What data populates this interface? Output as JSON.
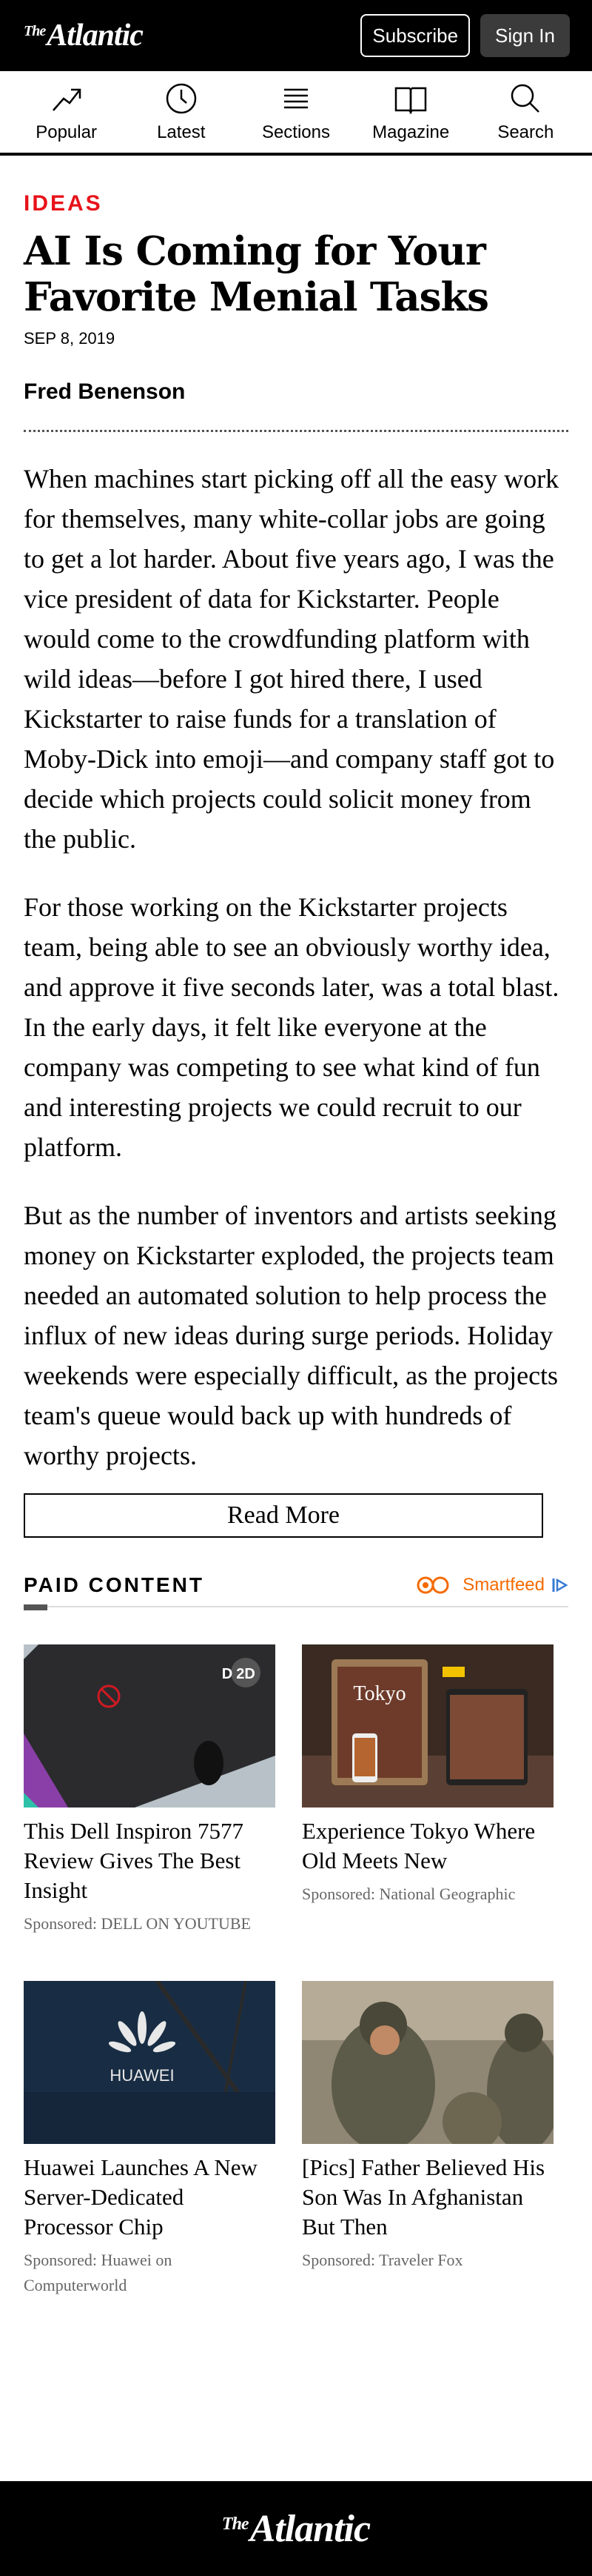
{
  "header": {
    "logo_the": "The",
    "logo_main": "Atlantic",
    "subscribe": "Subscribe",
    "sign_in": "Sign In"
  },
  "nav": [
    {
      "label": "Popular",
      "icon": "trending-up-icon"
    },
    {
      "label": "Latest",
      "icon": "clock-icon"
    },
    {
      "label": "Sections",
      "icon": "menu-icon"
    },
    {
      "label": "Magazine",
      "icon": "book-icon"
    },
    {
      "label": "Search",
      "icon": "search-icon"
    }
  ],
  "article": {
    "kicker": "IDEAS",
    "headline": "AI Is Coming for Your Favorite Menial Tasks",
    "date": "SEP 8, 2019",
    "author": "Fred Benenson",
    "paragraphs": [
      "When machines start picking off all the easy work for themselves, many white-collar jobs are going to get a lot harder. About five years ago, I was the vice president of data for Kickstarter. People would come to the crowdfunding platform with wild ideas—before I got hired there, I used Kickstarter to raise funds for a translation of Moby-Dick into emoji—and company staff got to decide which projects could solicit money from the public.",
      "For those working on the Kickstarter projects team, being able to see an obviously worthy idea, and approve it five seconds later, was a total blast. In the early days, it felt like everyone at the company was competing to see what kind of fun and interesting projects we could recruit to our platform.",
      "But as the number of inventors and artists seeking money on Kickstarter exploded, the projects team needed an automated solution to help process the influx of new ideas during surge periods. Holiday weekends were especially difficult, as the projects team's queue would back up with hundreds of worthy projects."
    ],
    "read_more": "Read More"
  },
  "paid": {
    "title": "PAID CONTENT",
    "smartfeed": "Smartfeed",
    "accent": "#f56a00",
    "cards": [
      {
        "title": "This Dell Inspiron 7577 Review Gives The Best Insight",
        "sponsor": "Sponsored: DELL ON YOUTUBE",
        "badge": "2D"
      },
      {
        "title": "Experience Tokyo Where Old Meets New",
        "sponsor": "Sponsored: National Geographic",
        "badge": "Tokyo"
      },
      {
        "title": "Huawei Launches A New Server-Dedicated Processor Chip",
        "sponsor": "Sponsored: Huawei on Computerworld",
        "badge": "HUAWEI"
      },
      {
        "title": "[Pics] Father Believed His Son Was In Afghanistan But Then",
        "sponsor": "Sponsored: Traveler Fox",
        "badge": ""
      }
    ]
  },
  "footer": {
    "logo_the": "The",
    "logo_main": "Atlantic"
  }
}
